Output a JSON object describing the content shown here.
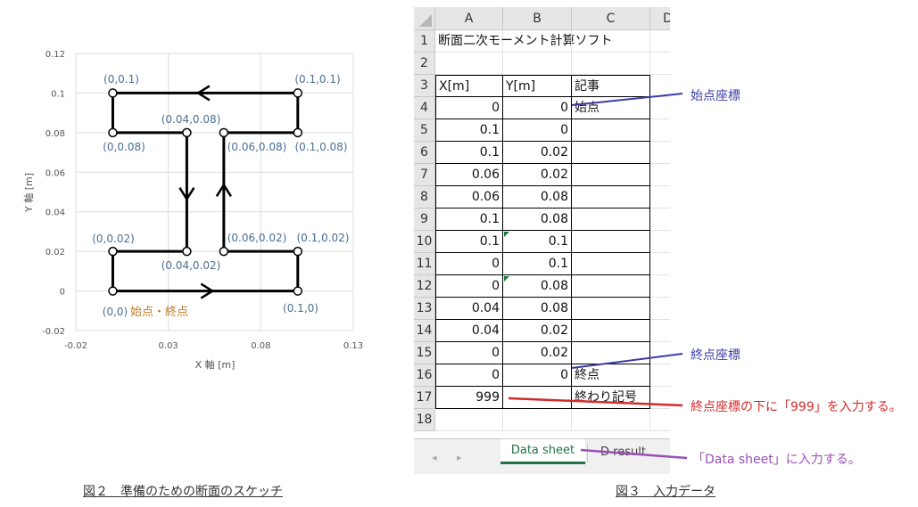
{
  "sketch": {
    "y_axis_label": "Y 軸 [m]",
    "x_axis_label": "X 軸 [m]",
    "y_ticks": [
      "0.12",
      "0.1",
      "0.08",
      "0.06",
      "0.04",
      "0.02",
      "0",
      "-0.02"
    ],
    "x_ticks": [
      "-0.02",
      "0.03",
      "0.08",
      "0.13"
    ],
    "point_labels": [
      "(0,0.1)",
      "(0.1,0.1)",
      "(0.04,0.08)",
      "(0,0.08)",
      "(0.06,0.08)",
      "(0.1,0.08)",
      "(0,0.02)",
      "(0.06,0.02)",
      "(0.1,0.02)",
      "(0.04,0.02)",
      "(0,0)",
      "(0.1,0)"
    ],
    "start_end_label": "始点・終点",
    "path_points": [
      [
        0,
        0
      ],
      [
        0.1,
        0
      ],
      [
        0.1,
        0.02
      ],
      [
        0.06,
        0.02
      ],
      [
        0.06,
        0.08
      ],
      [
        0.1,
        0.08
      ],
      [
        0.1,
        0.1
      ],
      [
        0,
        0.1
      ],
      [
        0,
        0.08
      ],
      [
        0.04,
        0.08
      ],
      [
        0.04,
        0.02
      ],
      [
        0,
        0.02
      ],
      [
        0,
        0
      ]
    ],
    "caption": "図２　準備のための断面のスケッチ"
  },
  "sheet": {
    "columns": [
      "A",
      "B",
      "C",
      "D"
    ],
    "rows": [
      {
        "n": "1",
        "a": "断面二次モーメント計算ソフト",
        "b": "",
        "c": ""
      },
      {
        "n": "2",
        "a": "",
        "b": "",
        "c": ""
      },
      {
        "n": "3",
        "a": "X[m]",
        "b": "Y[m]",
        "c": "記事"
      },
      {
        "n": "4",
        "a": "0",
        "b": "0",
        "c": "始点"
      },
      {
        "n": "5",
        "a": "0.1",
        "b": "0",
        "c": ""
      },
      {
        "n": "6",
        "a": "0.1",
        "b": "0.02",
        "c": ""
      },
      {
        "n": "7",
        "a": "0.06",
        "b": "0.02",
        "c": ""
      },
      {
        "n": "8",
        "a": "0.06",
        "b": "0.08",
        "c": ""
      },
      {
        "n": "9",
        "a": "0.1",
        "b": "0.08",
        "c": ""
      },
      {
        "n": "10",
        "a": "0.1",
        "b": "0.1",
        "c": ""
      },
      {
        "n": "11",
        "a": "0",
        "b": "0.1",
        "c": ""
      },
      {
        "n": "12",
        "a": "0",
        "b": "0.08",
        "c": ""
      },
      {
        "n": "13",
        "a": "0.04",
        "b": "0.08",
        "c": ""
      },
      {
        "n": "14",
        "a": "0.04",
        "b": "0.02",
        "c": ""
      },
      {
        "n": "15",
        "a": "0",
        "b": "0.02",
        "c": ""
      },
      {
        "n": "16",
        "a": "0",
        "b": "0",
        "c": "終点"
      },
      {
        "n": "17",
        "a": "999",
        "b": "",
        "c": "終わり記号"
      },
      {
        "n": "18",
        "a": "",
        "b": "",
        "c": ""
      }
    ],
    "tabs": [
      "Data sheet",
      "D result"
    ],
    "caption": "図３　入力データ"
  },
  "annotations": {
    "start": "始点座標",
    "end": "終点座標",
    "input_999": "終点座標の下に「999」を入力する。",
    "data_sheet": "「Data sheet」に入力する。"
  },
  "colors": {
    "label_blue": "#4a6f96",
    "label_orange": "#c07a2a",
    "ann_blue": "#3b3ba8",
    "ann_red": "#d22b2b",
    "ann_purple": "#9b4fb5",
    "tab_green": "#217346"
  }
}
